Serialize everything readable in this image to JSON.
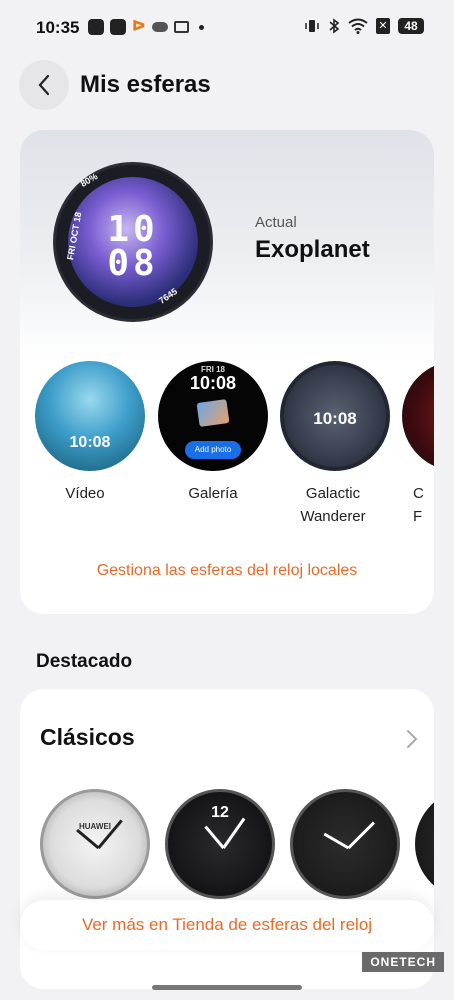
{
  "status_bar": {
    "time": "10:35",
    "battery": "48"
  },
  "header": {
    "title": "Mis esferas"
  },
  "current": {
    "label": "Actual",
    "name": "Exoplanet",
    "watch_hour": "10",
    "watch_minute": "08",
    "watch_battery": "80%",
    "watch_date": "FRI OCT 18",
    "watch_steps": "7645"
  },
  "faces": [
    {
      "label": "Vídeo",
      "time": "10:08"
    },
    {
      "label": "Galería",
      "time": "10:08",
      "date": "FRI 18",
      "button": "Add photo"
    },
    {
      "label": "Galactic Wanderer",
      "time": "10:08"
    },
    {
      "label": "C\nF"
    }
  ],
  "manage_link": "Gestiona las esferas del reloj locales",
  "featured": {
    "section_title": "Destacado",
    "collection_title": "Clásicos",
    "brand": "HUAWEI",
    "numeral": "12"
  },
  "store_button": "Ver más en Tienda de esferas del reloj",
  "watermark": "ONETECH"
}
